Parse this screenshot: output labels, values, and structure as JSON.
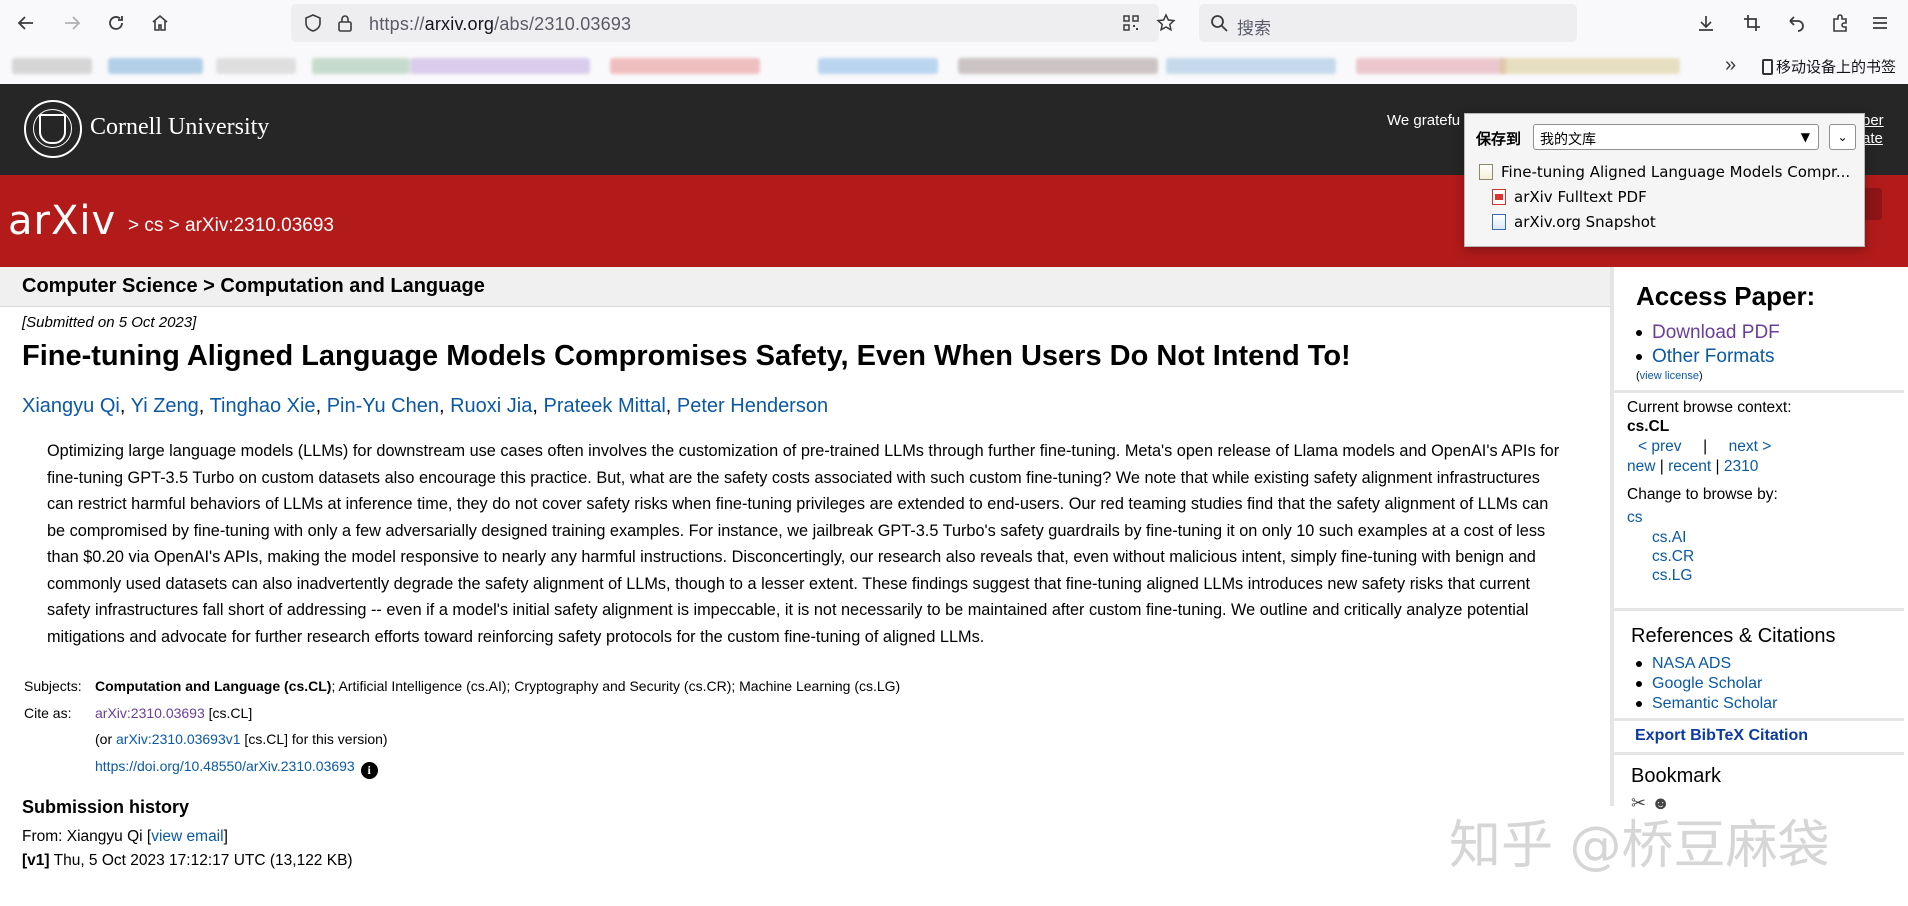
{
  "browser": {
    "url_prefix": "https://",
    "url_host": "arxiv.org",
    "url_path": "/abs/2310.03693",
    "search_placeholder": "搜索",
    "mobile_bookmarks": "移动设备上的书签"
  },
  "cornell": {
    "name": "Cornell University",
    "ack_partial": "We gratefu",
    "member_partial_1": "ber",
    "member_partial_2": "ate"
  },
  "arxiv": {
    "logo": "arXiv",
    "breadcrumb": "> cs > arXiv:2310.03693"
  },
  "paper": {
    "subject_header": "Computer Science > Computation and Language",
    "submitted": "[Submitted on 5 Oct 2023]",
    "title": "Fine-tuning Aligned Language Models Compromises Safety, Even When Users Do Not Intend To!",
    "authors": [
      "Xiangyu Qi",
      "Yi Zeng",
      "Tinghao Xie",
      "Pin-Yu Chen",
      "Ruoxi Jia",
      "Prateek Mittal",
      "Peter Henderson"
    ],
    "abstract": "Optimizing large language models (LLMs) for downstream use cases often involves the customization of pre-trained LLMs through further fine-tuning. Meta's open release of Llama models and OpenAI's APIs for fine-tuning GPT-3.5 Turbo on custom datasets also encourage this practice. But, what are the safety costs associated with such custom fine-tuning? We note that while existing safety alignment infrastructures can restrict harmful behaviors of LLMs at inference time, they do not cover safety risks when fine-tuning privileges are extended to end-users. Our red teaming studies find that the safety alignment of LLMs can be compromised by fine-tuning with only a few adversarially designed training examples. For instance, we jailbreak GPT-3.5 Turbo's safety guardrails by fine-tuning it on only 10 such examples at a cost of less than $0.20 via OpenAI's APIs, making the model responsive to nearly any harmful instructions. Disconcertingly, our research also reveals that, even without malicious intent, simply fine-tuning with benign and commonly used datasets can also inadvertently degrade the safety alignment of LLMs, though to a lesser extent. These findings suggest that fine-tuning aligned LLMs introduces new safety risks that current safety infrastructures fall short of addressing -- even if a model's initial safety alignment is impeccable, it is not necessarily to be maintained after custom fine-tuning. We outline and critically analyze potential mitigations and advocate for further research efforts toward reinforcing safety protocols for the custom fine-tuning of aligned LLMs.",
    "subjects_label": "Subjects:",
    "subjects_primary": "Computation and Language (cs.CL)",
    "subjects_rest": "; Artificial Intelligence (cs.AI); Cryptography and Security (cs.CR); Machine Learning (cs.LG)",
    "cite_label": "Cite as:",
    "cite_id": "arXiv:2310.03693",
    "cite_cat": " [cs.CL]",
    "cite_or_prefix": "(or ",
    "cite_version": "arXiv:2310.03693v1",
    "cite_or_suffix": " [cs.CL] for this version)",
    "doi": "https://doi.org/10.48550/arXiv.2310.03693",
    "history_title": "Submission history",
    "history_from_prefix": "From: Xiangyu Qi [",
    "history_view_email": "view email",
    "history_from_suffix": "]",
    "history_v1_label": "[v1]",
    "history_v1_text": " Thu, 5 Oct 2023 17:12:17 UTC (13,122 KB)"
  },
  "sidebar": {
    "access_title": "Access Paper:",
    "download_pdf": "Download PDF",
    "other_formats": "Other Formats",
    "view_license": "view license",
    "browse_context_label": "Current browse context:",
    "browse_context": "cs.CL",
    "prev": "< prev",
    "sep": "|",
    "next": "next >",
    "new": "new",
    "recent": "recent",
    "month": "2310",
    "change_browse": "Change to browse by:",
    "browse_cs": "cs",
    "browse_ai": "cs.AI",
    "browse_cr": "cs.CR",
    "browse_lg": "cs.LG",
    "refs_title": "References & Citations",
    "refs": [
      "NASA ADS",
      "Google Scholar",
      "Semantic Scholar"
    ],
    "bibtex": "Export BibTeX Citation",
    "bookmark_title": "Bookmark"
  },
  "zotero": {
    "label": "保存到",
    "library": "我的文库",
    "item_main": "Fine-tuning Aligned Language Models Compr...",
    "item_pdf": "arXiv Fulltext PDF",
    "item_snapshot": "arXiv.org Snapshot"
  },
  "watermark": "知乎 @桥豆麻袋",
  "icons": [
    "back-icon",
    "forward-icon",
    "reload-icon",
    "home-icon",
    "shield-icon",
    "lock-icon",
    "qr-icon",
    "star-icon",
    "search-icon",
    "download-icon",
    "crop-icon",
    "undo-icon",
    "extensions-icon",
    "menu-icon"
  ]
}
